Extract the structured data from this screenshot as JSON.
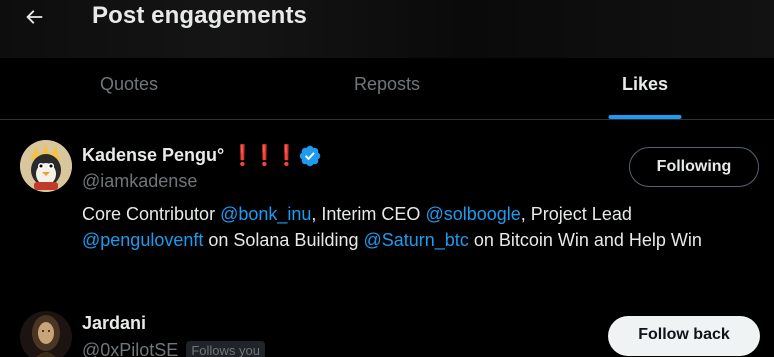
{
  "header": {
    "title": "Post engagements"
  },
  "tabs": [
    {
      "label": "Quotes",
      "active": false
    },
    {
      "label": "Reposts",
      "active": false
    },
    {
      "label": "Likes",
      "active": true
    }
  ],
  "accent_color": "#1d9bf0",
  "users": [
    {
      "name": "Kadense Pengu°",
      "name_decoration": "❗❗❗",
      "verified": true,
      "handle": "@iamkadense",
      "follow_button": "Following",
      "bio_parts": [
        {
          "text": "Core Contributor ",
          "mention": false
        },
        {
          "text": "@bonk_inu",
          "mention": true
        },
        {
          "text": ", Interim CEO ",
          "mention": false
        },
        {
          "text": "@solboogle",
          "mention": true
        },
        {
          "text": ", Project Lead ",
          "mention": false
        },
        {
          "text": "@penguloven﻿ft",
          "mention": true
        },
        {
          "text": " on Solana Building ",
          "mention": false
        },
        {
          "text": "@Saturn_btc",
          "mention": true
        },
        {
          "text": " on Bitcoin Win and Help Win",
          "mention": false
        }
      ]
    },
    {
      "name": "Jardani",
      "verified": false,
      "handle": "@0xPilotSE",
      "follows_you": "Follows you",
      "follow_button": "Follow back"
    }
  ]
}
